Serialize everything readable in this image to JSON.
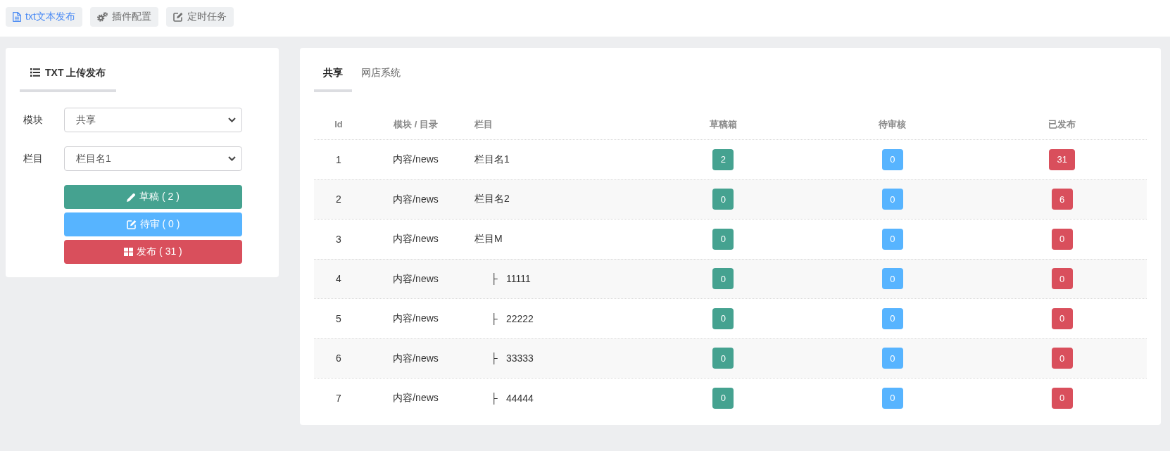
{
  "nav": [
    {
      "label": "txt文本发布",
      "selected": true
    },
    {
      "label": "插件配置",
      "selected": false
    },
    {
      "label": "定时任务",
      "selected": false
    }
  ],
  "upload_panel": {
    "title": "TXT 上传发布",
    "fields": [
      {
        "label": "模块",
        "value": "共享"
      },
      {
        "label": "栏目",
        "value": "栏目名1"
      }
    ],
    "actions": [
      {
        "label": "草稿 ( 2 )",
        "color": "#45a290"
      },
      {
        "label": "待审 ( 0 )",
        "color": "#57b4ff"
      },
      {
        "label": "发布 ( 31 )",
        "color": "#d94f5c"
      }
    ]
  },
  "table_panel": {
    "tabs": [
      {
        "label": "共享",
        "selected": true
      },
      {
        "label": "网店系统",
        "selected": false
      }
    ],
    "table": {
      "columns": [
        {
          "label": "Id"
        },
        {
          "label": "模块 / 目录"
        },
        {
          "label": "栏目"
        },
        {
          "label": "草稿箱",
          "color": "#45a290"
        },
        {
          "label": "待审核",
          "color": "#57b4ff"
        },
        {
          "label": "已发布",
          "color": "#d94f5c"
        }
      ],
      "rows": [
        {
          "id": "1",
          "module": "内容/news",
          "name": "栏目名1",
          "counts": [
            "2",
            "0",
            "31"
          ]
        },
        {
          "id": "2",
          "module": "内容/news",
          "name": "栏目名2",
          "counts": [
            "0",
            "0",
            "6"
          ]
        },
        {
          "id": "3",
          "module": "内容/news",
          "name": "栏目M",
          "counts": [
            "0",
            "0",
            "0"
          ],
          "children": [
            {
              "id": "4",
              "module": "内容/news",
              "branch": "├",
              "name": "11111",
              "counts": [
                "0",
                "0",
                "0"
              ]
            },
            {
              "id": "5",
              "module": "内容/news",
              "branch": "├",
              "name": "22222",
              "counts": [
                "0",
                "0",
                "0"
              ]
            },
            {
              "id": "6",
              "module": "内容/news",
              "branch": "├",
              "name": "33333",
              "counts": [
                "0",
                "0",
                "0"
              ]
            },
            {
              "id": "7",
              "module": "内容/news",
              "branch": "├",
              "name": "44444",
              "counts": [
                "0",
                "0",
                "0"
              ]
            }
          ]
        }
      ]
    }
  }
}
